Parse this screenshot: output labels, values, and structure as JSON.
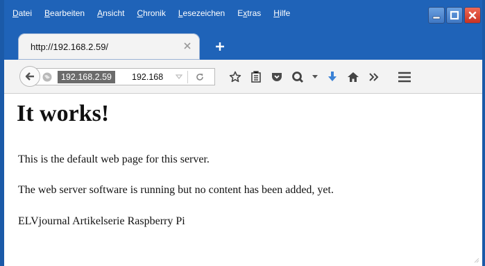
{
  "menubar": {
    "items": [
      {
        "accel": "D",
        "rest": "atei"
      },
      {
        "accel": "B",
        "rest": "earbeiten"
      },
      {
        "accel": "A",
        "rest": "nsicht"
      },
      {
        "accel": "C",
        "rest": "hronik"
      },
      {
        "accel": "L",
        "rest": "esezeichen"
      },
      {
        "pre": "E",
        "accel": "x",
        "rest": "tras"
      },
      {
        "accel": "H",
        "rest": "ilfe"
      }
    ]
  },
  "tab": {
    "title": "http://192.168.2.59/"
  },
  "urlbar": {
    "selected_text": "192.168.2.59",
    "rest_text": "192.168"
  },
  "page": {
    "heading": "It works!",
    "paragraphs": [
      "This is the default web page for this server.",
      "The web server software is running but no content has been added, yet.",
      "ELVjournal Artikelserie Raspberry Pi"
    ]
  },
  "icons": [
    "back-arrow-icon",
    "globe-icon",
    "dropdown-arrow-icon",
    "reload-icon",
    "star-icon",
    "reading-list-icon",
    "pocket-icon",
    "quickpanel-icon",
    "download-icon",
    "home-icon",
    "overflow-icon",
    "hamburger-menu-icon",
    "close-icon",
    "new-tab-icon"
  ],
  "colors": {
    "window_frame": "#1f63b8",
    "chrome_bg": "#f3f3f3",
    "selection": "#6b6b6b",
    "download_blue": "#3b82d6",
    "close_red": "#d43c2b"
  }
}
